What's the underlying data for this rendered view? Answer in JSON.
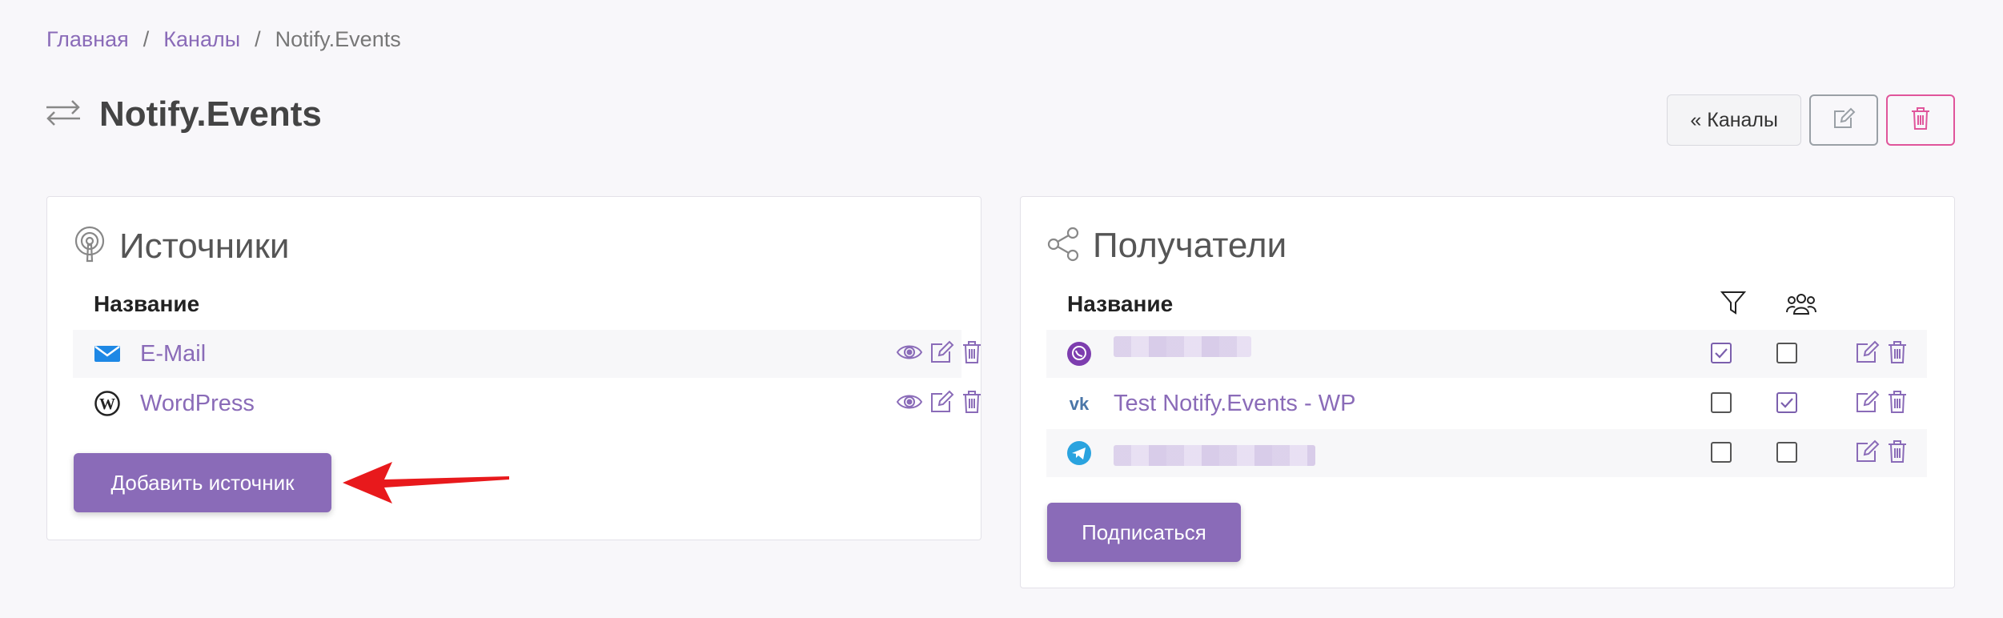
{
  "breadcrumb": {
    "items": [
      "Главная",
      "Каналы",
      "Notify.Events"
    ],
    "separator": "/"
  },
  "page": {
    "title": "Notify.Events",
    "back_button": "« Каналы"
  },
  "sources": {
    "title": "Источники",
    "column_name": "Название",
    "rows": [
      {
        "label": "E-Mail",
        "icon": "email-icon"
      },
      {
        "label": "WordPress",
        "icon": "wordpress-icon"
      }
    ],
    "add_button": "Добавить источник"
  },
  "recipients": {
    "title": "Получатели",
    "column_name": "Название",
    "column_filter_icon": "filter-icon",
    "column_group_icon": "users-icon",
    "rows": [
      {
        "label": "",
        "icon": "viber-icon",
        "filter": true,
        "group": false
      },
      {
        "label": "Test Notify.Events - WP",
        "icon": "vk-icon",
        "filter": false,
        "group": true
      },
      {
        "label": "",
        "icon": "telegram-icon",
        "filter": false,
        "group": false
      }
    ],
    "subscribe_button": "Подписаться"
  },
  "colors": {
    "accent": "#8a6bb8",
    "danger": "#e0559b",
    "arrow": "#e8191c"
  }
}
